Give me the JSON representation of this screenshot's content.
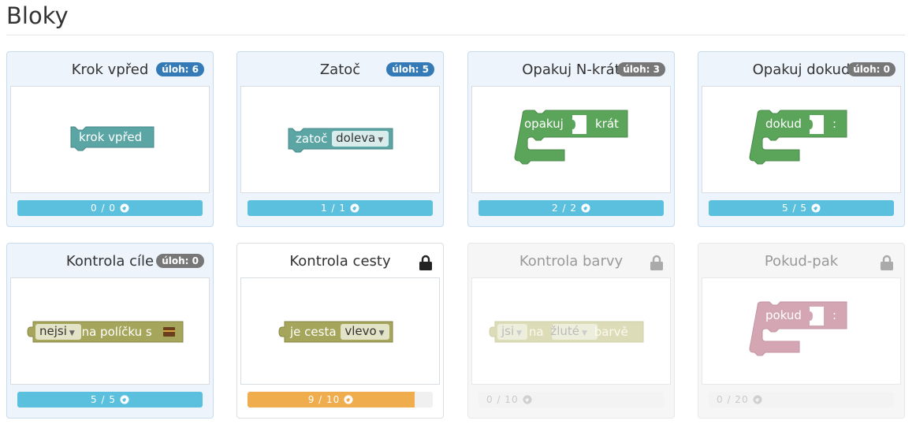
{
  "page": {
    "title": "Bloky"
  },
  "cards": [
    {
      "title": "Krok vpřed",
      "badge": "úloh: 6",
      "block": {
        "text": "krok vpřed"
      },
      "progress": {
        "label": "0 / 0",
        "fraction": 1.0
      },
      "locked": false
    },
    {
      "title": "Zatoč",
      "badge": "úloh: 5",
      "block": {
        "text": "zatoč",
        "dropdown": "doleva"
      },
      "progress": {
        "label": "1 / 1",
        "fraction": 1.0
      },
      "locked": false
    },
    {
      "title": "Opakuj N-krát",
      "badge": "úloh: 3",
      "block": {
        "text": "opakuj",
        "suffix": "krát"
      },
      "progress": {
        "label": "2 / 2",
        "fraction": 1.0
      },
      "locked": false
    },
    {
      "title": "Opakuj dokud",
      "badge": "úloh: 0",
      "block": {
        "text": "dokud",
        "suffix": ":"
      },
      "progress": {
        "label": "5 / 5",
        "fraction": 1.0
      },
      "locked": false
    },
    {
      "title": "Kontrola cíle",
      "badge": "úloh: 0",
      "block": {
        "dropdown": "nejsi",
        "text": "na políčku s"
      },
      "progress": {
        "label": "5 / 5",
        "fraction": 1.0
      },
      "locked": false
    },
    {
      "title": "Kontrola cesty",
      "block": {
        "text": "je cesta",
        "dropdown": "vlevo"
      },
      "progress": {
        "label": "9 / 10",
        "fraction": 0.9
      },
      "locked": true,
      "lock_icon": "lock-icon"
    },
    {
      "title": "Kontrola barvy",
      "block": {
        "dropdown": "jsi",
        "text": "na",
        "dropdown2": "žluté",
        "suffix": "barvě"
      },
      "progress": {
        "label": "0 / 10",
        "fraction": 0.0
      },
      "locked": true,
      "lock_icon": "lock-icon"
    },
    {
      "title": "Pokud-pak",
      "block": {
        "text": "pokud",
        "suffix": ":"
      },
      "progress": {
        "label": "0 / 20",
        "fraction": 0.0
      },
      "locked": true,
      "lock_icon": "lock-icon"
    }
  ],
  "colors": {
    "badge_blue": "#337ab7",
    "badge_grey": "#777777",
    "progress_info": "#5bc0de",
    "progress_warning": "#f0ad4e",
    "block_teal": "#5ba5a5",
    "block_green": "#5ba55b",
    "block_olive": "#a5a55b",
    "block_pink": "#d4a6b3"
  }
}
